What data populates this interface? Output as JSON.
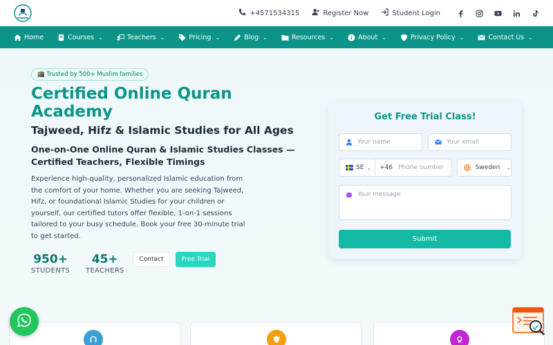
{
  "topbar": {
    "logo": "academy-logo",
    "phone": "+4571534315",
    "register": "Register Now",
    "login": "Student Login",
    "social": [
      "facebook-icon",
      "instagram-icon",
      "youtube-icon",
      "linkedin-icon",
      "tiktok-icon"
    ]
  },
  "nav": {
    "items": [
      {
        "label": "Home",
        "icon": "home-icon",
        "dropdown": false
      },
      {
        "label": "Courses",
        "icon": "book-icon",
        "dropdown": true
      },
      {
        "label": "Teachers",
        "icon": "teacher-icon",
        "dropdown": true
      },
      {
        "label": "Pricing",
        "icon": "tag-icon",
        "dropdown": true
      },
      {
        "label": "Blog",
        "icon": "pen-icon",
        "dropdown": true
      },
      {
        "label": "Resources",
        "icon": "folder-icon",
        "dropdown": true
      },
      {
        "label": "About",
        "icon": "info-icon",
        "dropdown": true
      },
      {
        "label": "Privacy Policy",
        "icon": "shield-icon",
        "dropdown": true
      },
      {
        "label": "Contact Us",
        "icon": "envelope-icon",
        "dropdown": true
      }
    ]
  },
  "hero": {
    "badge": "🕋 Trusted by 500+ Muslim families",
    "title": "Certified Online Quran Academy",
    "subtitle": "Tajweed, Hifz & Islamic Studies for All Ages",
    "tagline": "One-on-One Online Quran & Islamic Studies Classes — Certified Teachers, Flexible Timings",
    "description": "Experience high-quality, personalized Islamic education from the comfort of your home. Whether you are seeking Tajweed, Hifz, or foundational Islamic Studies for your children or yourself, our certified tutors offer flexible, 1-on-1 sessions tailored to your busy schedule. Book your free 30-minute trial to get started.",
    "stats": [
      {
        "value": "950+",
        "label": "STUDENTS"
      },
      {
        "value": "45+",
        "label": "TEACHERS"
      }
    ],
    "contact_label": "Contact",
    "trial_label": "Free Trial"
  },
  "form": {
    "title": "Get Free Trial Class!",
    "name_placeholder": "Your name",
    "email_placeholder": "Your email",
    "country_code": "SE",
    "dial_code": "+46",
    "phone_placeholder": "Phone number",
    "country": "Sweden",
    "message_placeholder": "Your message",
    "submit_label": "Submit"
  },
  "colors": {
    "brand": "#0d9488",
    "accent": "#14b8a6",
    "whatsapp": "#22c55e"
  }
}
